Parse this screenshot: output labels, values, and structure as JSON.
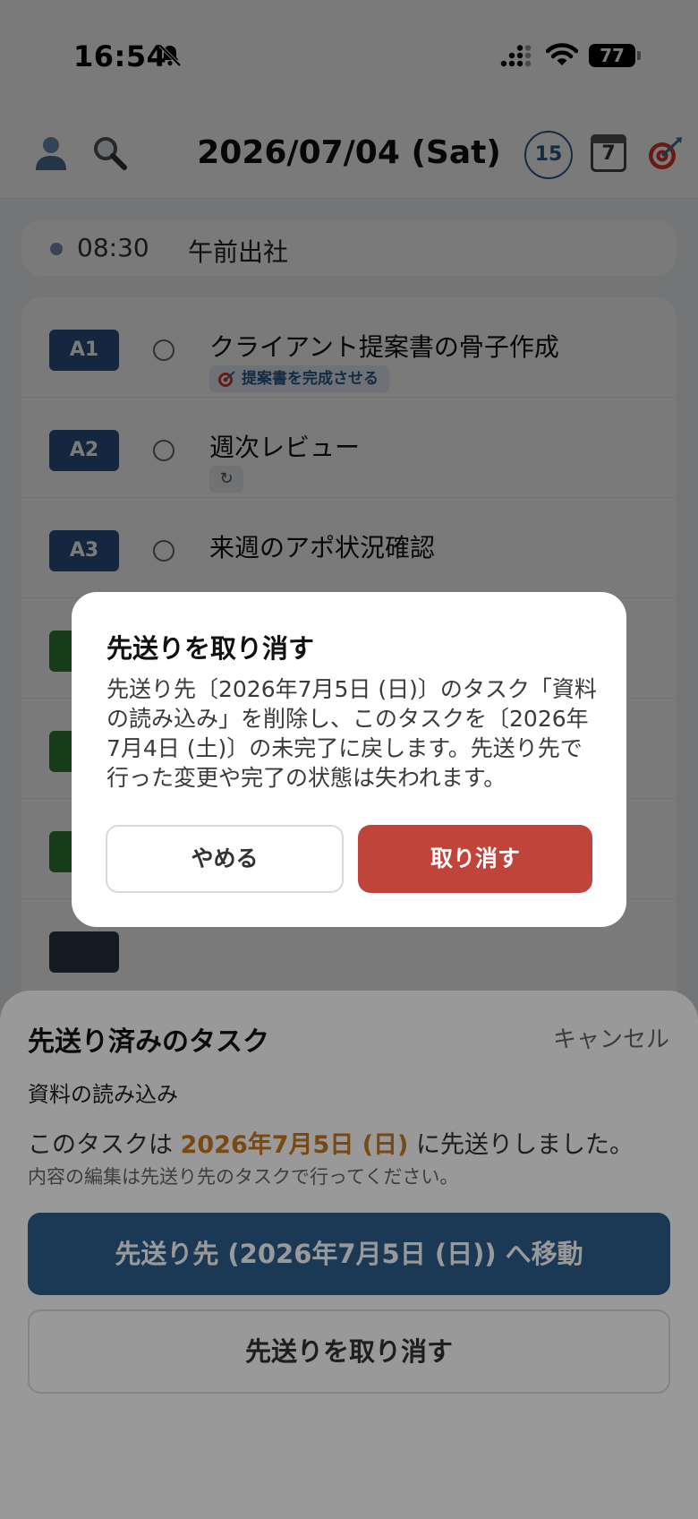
{
  "status_bar": {
    "time": "16:54",
    "battery": "77"
  },
  "header": {
    "date": "2026/07/04 (Sat)",
    "count_badge": "15",
    "calendar_day": "7"
  },
  "schedule": {
    "time": "08:30",
    "title": "午前出社"
  },
  "tasks": [
    {
      "priority": "A1",
      "title": "クライアント提案書の骨子作成",
      "tag": "提案書を完成させる"
    },
    {
      "priority": "A2",
      "title": "週次レビュー"
    },
    {
      "priority": "A3",
      "title": "来週のアポ状況確認"
    }
  ],
  "sheet": {
    "title": "先送り済みのタスク",
    "cancel": "キャンセル",
    "task_name": "資料の読み込み",
    "msg_prefix": "このタスクは",
    "msg_date": "2026年7月5日 (日)",
    "msg_suffix": "に先送りしました。",
    "note": "内容の編集は先送り先のタスクで行ってください。",
    "move_button": "先送り先 (2026年7月5日 (日)) へ移動",
    "undo_button": "先送りを取り消す"
  },
  "dialog": {
    "title": "先送りを取り消す",
    "body": "先送り先〔2026年7月5日 (日)〕のタスク「資料の読み込み」を削除し、このタスクを〔2026年7月4日 (土)〕の未完了に戻します。先送り先で行った変更や完了の状態は失われます。",
    "cancel": "やめる",
    "confirm": "取り消す"
  }
}
